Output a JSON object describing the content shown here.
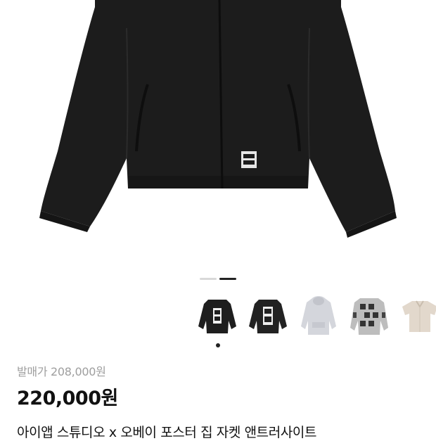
{
  "product": {
    "image_description_icon": "black-zip-jacket-image",
    "original_price_label": "발매가 208,000원",
    "price_label": "220,000원",
    "title": "아이앱 스튜디오 x 오베이 포스터 집 자켓 앤트러사이트"
  },
  "gallery": {
    "indicator": {
      "inactive_color": "#d9d9d9",
      "active_color": "#222222",
      "active_index": 1
    },
    "thumbnails": [
      {
        "icon": "black-jacket-back-thumbnail",
        "selected": true
      },
      {
        "icon": "black-jacket-back-poster-thumbnail",
        "selected": false
      },
      {
        "icon": "grey-hoodie-thumbnail",
        "selected": false
      },
      {
        "icon": "patterned-sweater-thumbnail",
        "selected": false
      },
      {
        "icon": "beige-shirt-thumbnail",
        "selected": false
      }
    ]
  },
  "colors": {
    "jacket": "#1c1c1c",
    "text_primary": "#111111",
    "text_muted": "#9e9e9e"
  }
}
